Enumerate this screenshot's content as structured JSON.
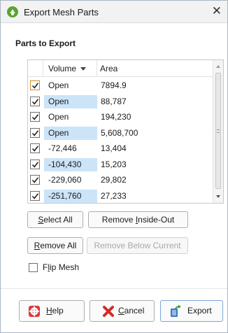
{
  "window": {
    "title": "Export Mesh Parts",
    "close_glyph": "✕"
  },
  "section": {
    "label": "Parts to Export"
  },
  "table": {
    "headers": {
      "volume": "Volume",
      "area": "Area"
    },
    "rows": [
      {
        "checked": true,
        "volume": "Open",
        "area": "7894.9",
        "highlight": false
      },
      {
        "checked": true,
        "volume": "Open",
        "area": "88,787",
        "highlight": true
      },
      {
        "checked": true,
        "volume": "Open",
        "area": "194,230",
        "highlight": false
      },
      {
        "checked": true,
        "volume": "Open",
        "area": "5,608,700",
        "highlight": true
      },
      {
        "checked": true,
        "volume": "-72,446",
        "area": "13,404",
        "highlight": false
      },
      {
        "checked": true,
        "volume": "-104,430",
        "area": "15,203",
        "highlight": true
      },
      {
        "checked": true,
        "volume": "-229,060",
        "area": "29,802",
        "highlight": false
      },
      {
        "checked": true,
        "volume": "-251,760",
        "area": "27,233",
        "highlight": true
      }
    ]
  },
  "buttons": {
    "select_all": {
      "pre": "",
      "key": "S",
      "post": "elect All"
    },
    "remove_inside_out": {
      "pre": "Remove ",
      "key": "I",
      "post": "nside-Out"
    },
    "remove_all": {
      "pre": "",
      "key": "R",
      "post": "emove All"
    },
    "remove_below_current": "Remove Below Current"
  },
  "flip_mesh": {
    "checked": false,
    "pre": "F",
    "key": "l",
    "post": "ip Mesh"
  },
  "footer": {
    "help": {
      "key": "H",
      "post": "elp",
      "icon": "lifebuoy-icon"
    },
    "cancel": {
      "key": "C",
      "post": "ancel",
      "icon": "red-x-icon"
    },
    "export": {
      "text": "Export",
      "icon": "export-icon"
    }
  },
  "colors": {
    "app_icon": "#5aa332",
    "row_highlight": "#cce4f7",
    "focus_checkbox": "#d48b1f"
  }
}
